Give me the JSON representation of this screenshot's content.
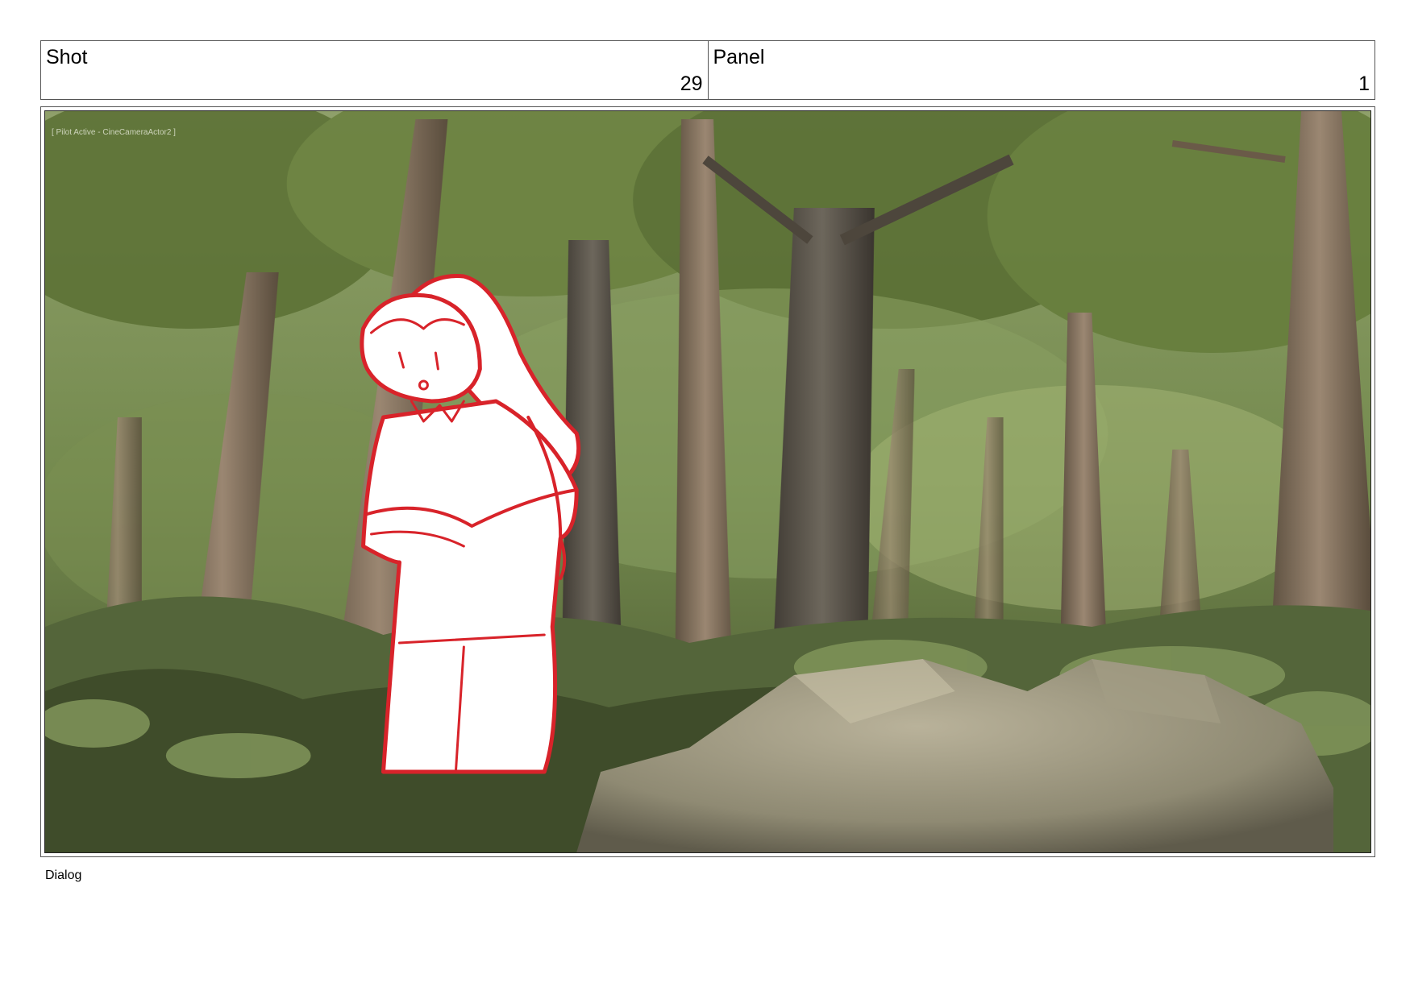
{
  "header": {
    "shot_label": "Shot",
    "shot_number": "29",
    "panel_label": "Panel",
    "panel_number": "1"
  },
  "frame": {
    "hud_text": "[ Pilot Active - CineCameraActor2 ]",
    "character_line_color": "#d8232a",
    "scene": "forest-with-rocks"
  },
  "footer": {
    "dialog_label": "Dialog"
  }
}
